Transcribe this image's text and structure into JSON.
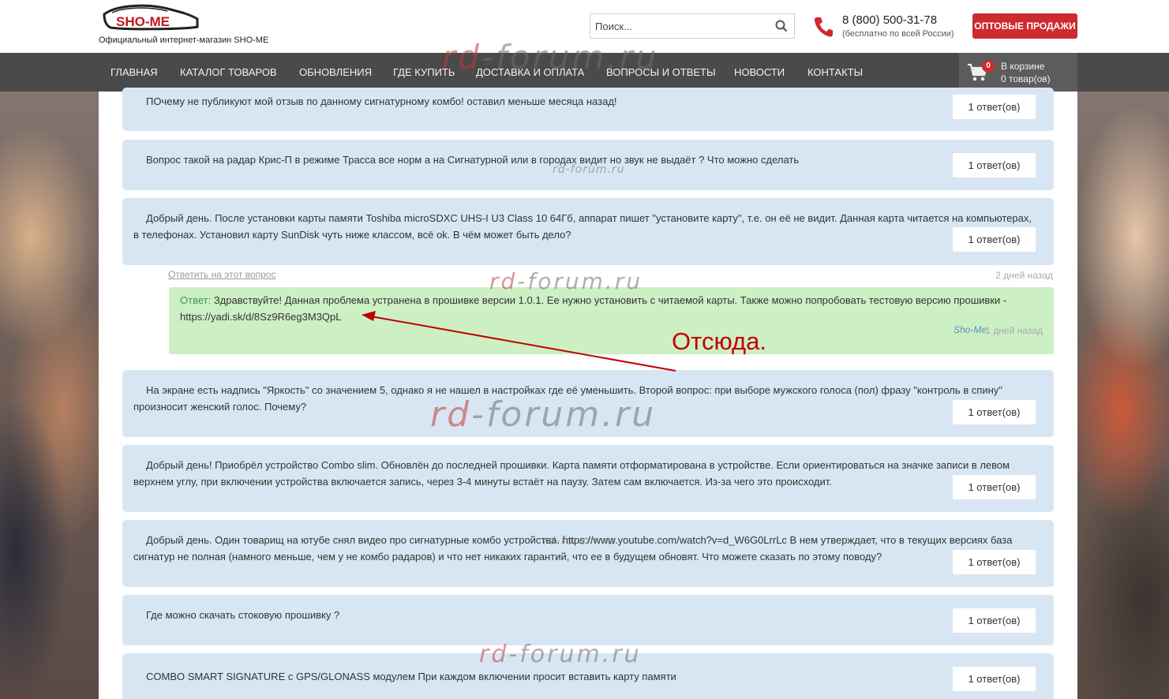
{
  "header": {
    "logo_text": "SHO-ME",
    "tagline": "Официальный интернет-магазин SHO-ME",
    "search_placeholder": "Поиск...",
    "phone": "8 (800) 500-31-78",
    "phone_note": "(бесплатно по всей России)",
    "wholesale_button": "ОПТОВЫЕ ПРОДАЖИ"
  },
  "nav": {
    "items": [
      {
        "label": "ГЛАВНАЯ"
      },
      {
        "label": "КАТАЛОГ ТОВАРОВ"
      },
      {
        "label": "ОБНОВЛЕНИЯ"
      },
      {
        "label": "ГДЕ КУПИТЬ"
      },
      {
        "label": "ДОСТАВКА И ОПЛАТА"
      },
      {
        "label": "ВОПРОСЫ И ОТВЕТЫ"
      },
      {
        "label": "НОВОСТИ"
      },
      {
        "label": "КОНТАКТЫ"
      }
    ]
  },
  "cart": {
    "count": "0",
    "line1": "В корзине",
    "line2": "0 товар(ов)"
  },
  "questions": [
    {
      "text": "ПОчему не публикуют мой отзыв по данному сигнатурному комбо! оставил меньше месяца назад!",
      "answers_label": "1 ответ(ов)"
    },
    {
      "text": "Вопрос такой на радар Крис-П в режиме Трасса все норм а на Сигнатурной или в городах видит но звук не выдаёт ? Что можно сделать",
      "answers_label": "1 ответ(ов)"
    },
    {
      "text": "Добрый день. После установки карты памяти Toshiba microSDXC UHS-I U3 Class 10 64Гб, аппарат пишет \"установите карту\", т.е. он её не видит. Данная карта читается на компьютерах, в телефонах. Установил карту SunDisk чуть ниже классом, всё ok. В чём может быть дело?",
      "answers_label": "1 ответ(ов)"
    },
    {
      "text": "На экране есть надпись \"Яркость\" со значением 5, однако я не нашел в настройках где её уменьшить. Второй вопрос: при выборе мужского голоса (пол) фразу \"контроль в спину\" произносит женский голос. Почему?",
      "answers_label": "1 ответ(ов)"
    },
    {
      "text": "Добрый день! Приобрёл устройство Combo slim. Обновлён до последней прошивки. Карта памяти отформатирована в устройстве. Если ориентироваться на значке записи в левом верхнем углу, при включении устройства включается запись, через 3-4 минуты встаёт на паузу. Затем сам включается. Из-за чего это происходит.",
      "answers_label": "1 ответ(ов)"
    },
    {
      "text": "Добрый день. Один товарищ на ютубе снял видео про сигнатурные комбо устройства. https://www.youtube.com/watch?v=d_W6G0LrrLc В нем утверждает, что в текущих версиях база сигнатур не полная (намного меньше, чем у не комбо радаров) и что нет никаких гарантий, что ее в будущем обновят. Что можете сказать по этому поводу?",
      "answers_label": "1 ответ(ов)"
    },
    {
      "text": "Где можно скачать стоковую прошивку ?",
      "answers_label": "1 ответ(ов)"
    },
    {
      "text": "COMBO SMART SIGNATURE с GPS/GLONASS модулем При каждом включении просит вставить карту памяти",
      "answers_label": "1 ответ(ов)"
    }
  ],
  "open_answer": {
    "reply_link": "Ответить на этот вопрос",
    "question_date": "2 дней назад",
    "prefix": "Ответ:",
    "text": "Здравствуйте! Данная проблема устранена в прошивке версии 1.0.1. Ее нужно установить с читаемой карты. Также можно попробовать тестовую версию прошивки - https://yadi.sk/d/8Sz9R6eg3M3QpL",
    "author": "Sho-Me",
    "date": "1 дней назад"
  },
  "annotation": {
    "label": "Отсюда.",
    "color": "#c00000"
  },
  "watermark": {
    "text": "rd-forum.ru",
    "prefix": "rd",
    "rest": "-forum.ru"
  },
  "colors": {
    "brand_red": "#cf2a2f",
    "nav_bg": "#4a4a4a",
    "question_bg": "#d8e6f3",
    "answer_bg": "#ccefc3"
  }
}
